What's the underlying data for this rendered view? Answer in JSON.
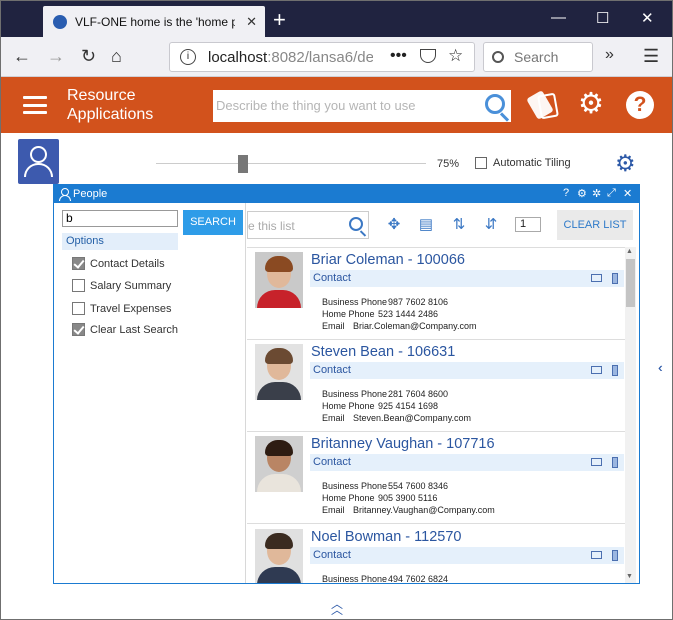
{
  "browser": {
    "tab_title": "VLF-ONE home is the 'home page'",
    "tab_close": "✕",
    "new_tab": "+",
    "url_host": "localhost",
    "url_rest": ":8082/lansa6/de",
    "search_placeholder": "Search",
    "menu_dots": "•••"
  },
  "app": {
    "brand_line1": "Resource",
    "brand_line2": "Applications",
    "search_placeholder": "Describe the thing you want to use",
    "help_label": "?"
  },
  "toolbar": {
    "zoom_level": "75%",
    "slider_fraction": 0.32,
    "auto_tiling_label": "Automatic Tiling",
    "auto_tiling_checked": false
  },
  "people_window": {
    "title": "People",
    "search_value": "b",
    "search_button": "SEARCH",
    "options_header": "Options",
    "options": [
      {
        "label": "Contact Details",
        "checked": true
      },
      {
        "label": "Salary Summary",
        "checked": false
      },
      {
        "label": "Travel Expenses",
        "checked": false
      },
      {
        "label": "Clear Last Search",
        "checked": true
      }
    ],
    "filter_placeholder": "e this list",
    "page_value": "1",
    "clear_list_button": "CLEAR LIST",
    "contacts": [
      {
        "name": "Briar Coleman - 100066",
        "section": "Contact",
        "business_phone_label": "Business Phone",
        "business_phone": "987 7602 8106",
        "home_phone_label": "Home Phone",
        "home_phone": "523 1444 2486",
        "email_label": "Email",
        "email": "Briar.Coleman@Company.com"
      },
      {
        "name": "Steven Bean - 106631",
        "section": "Contact",
        "business_phone_label": "Business Phone",
        "business_phone": "281 7604 8600",
        "home_phone_label": "Home Phone",
        "home_phone": "925 4154 1698",
        "email_label": "Email",
        "email": "Steven.Bean@Company.com"
      },
      {
        "name": "Britanney Vaughan - 107716",
        "section": "Contact",
        "business_phone_label": "Business Phone",
        "business_phone": "554 7600 8346",
        "home_phone_label": "Home Phone",
        "home_phone": "905 3900 5116",
        "email_label": "Email",
        "email": "Britanney.Vaughan@Company.com"
      },
      {
        "name": "Noel Bowman - 112570",
        "section": "Contact",
        "business_phone_label": "Business Phone",
        "business_phone": "494 7602 6824"
      }
    ]
  },
  "colors": {
    "header_orange": "#d2521c",
    "window_blue": "#1b7bd1",
    "button_blue": "#2e9ce8",
    "link_blue": "#2b56a0"
  }
}
